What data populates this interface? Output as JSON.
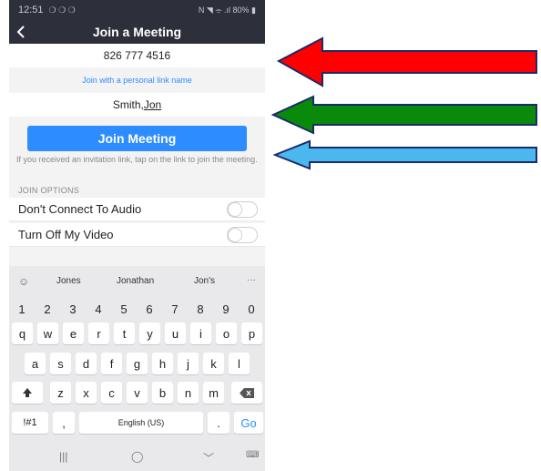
{
  "status_bar": {
    "time": "12:51",
    "left_icons": "❍ ❍ ❍",
    "right_icons": "N ◥ ⌯ .ıl 80% ▮"
  },
  "header": {
    "title": "Join a Meeting"
  },
  "meeting": {
    "meeting_id": "826 777 4516",
    "personal_link_label": "Join with a personal link name",
    "name_first": "Smith, ",
    "name_last": "Jon",
    "join_button": "Join Meeting",
    "invite_hint": "If you received an invitation link, tap on the link to join the meeting."
  },
  "options": {
    "header": "JOIN OPTIONS",
    "items": [
      {
        "label": "Don't Connect To Audio",
        "enabled": false
      },
      {
        "label": "Turn Off My Video",
        "enabled": false
      }
    ]
  },
  "keyboard": {
    "suggestions": [
      "Jones",
      "Jonathan",
      "Jon's"
    ],
    "more": "···",
    "numbers": [
      "1",
      "2",
      "3",
      "4",
      "5",
      "6",
      "7",
      "8",
      "9",
      "0"
    ],
    "row1": [
      "q",
      "w",
      "e",
      "r",
      "t",
      "y",
      "u",
      "i",
      "o",
      "p"
    ],
    "row2": [
      "a",
      "s",
      "d",
      "f",
      "g",
      "h",
      "j",
      "k",
      "l"
    ],
    "row3": [
      "z",
      "x",
      "c",
      "v",
      "b",
      "n",
      "m"
    ],
    "symbols_key": "!#1",
    "comma_key": ",",
    "space_label": "English (US)",
    "period_key": ".",
    "go_key": "Go",
    "shift_icon": "shift-icon",
    "backspace_icon": "backspace-icon"
  },
  "nav_bar": {
    "recent": "|||",
    "home": "◯",
    "back": "﹀",
    "kb": "⌨"
  },
  "arrows": [
    {
      "color": "#ff0000"
    },
    {
      "color": "#0a8a0a"
    },
    {
      "color": "#4ab8ee"
    }
  ]
}
